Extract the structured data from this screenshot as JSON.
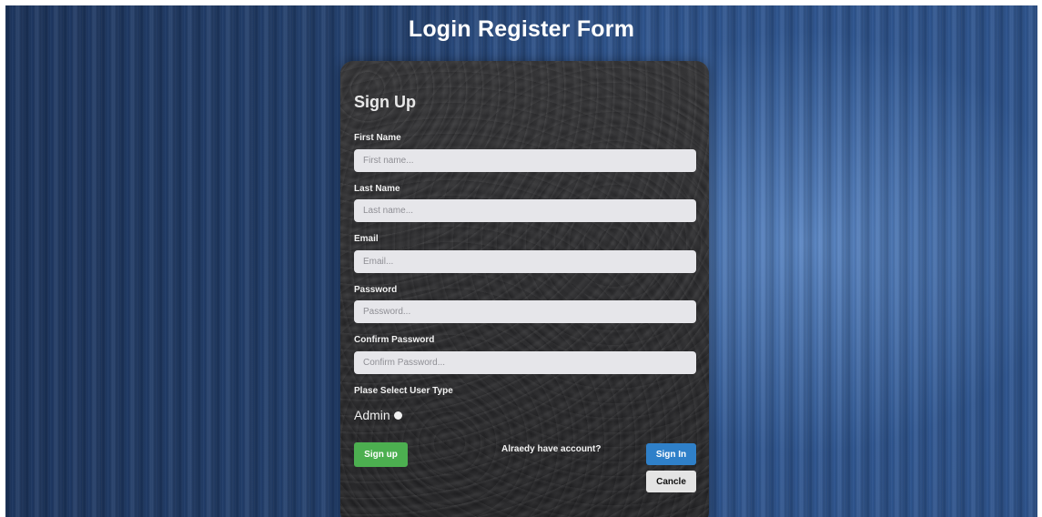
{
  "page": {
    "title": "Login Register Form"
  },
  "form": {
    "title": "Sign Up",
    "fields": [
      {
        "label": "First Name",
        "placeholder": "First name...",
        "value": ""
      },
      {
        "label": "Last Name",
        "placeholder": "Last name...",
        "value": ""
      },
      {
        "label": "Email",
        "placeholder": "Email...",
        "value": ""
      },
      {
        "label": "Password",
        "placeholder": "Password...",
        "value": ""
      },
      {
        "label": "Confirm Password",
        "placeholder": "Confirm Password...",
        "value": ""
      }
    ],
    "user_type": {
      "label": "Plase Select User Type",
      "options": [
        {
          "label": "Admin"
        }
      ]
    },
    "signup_label": "Sign up",
    "already_text": "Alraedy have account?",
    "signin_label": "Sign In",
    "cancel_label": "Cancle"
  },
  "colors": {
    "signup_button": "#4caf50",
    "signin_button": "#2f80c9",
    "cancel_button": "#e4e4e4",
    "background": "#2a4d84",
    "card": "#232325"
  }
}
